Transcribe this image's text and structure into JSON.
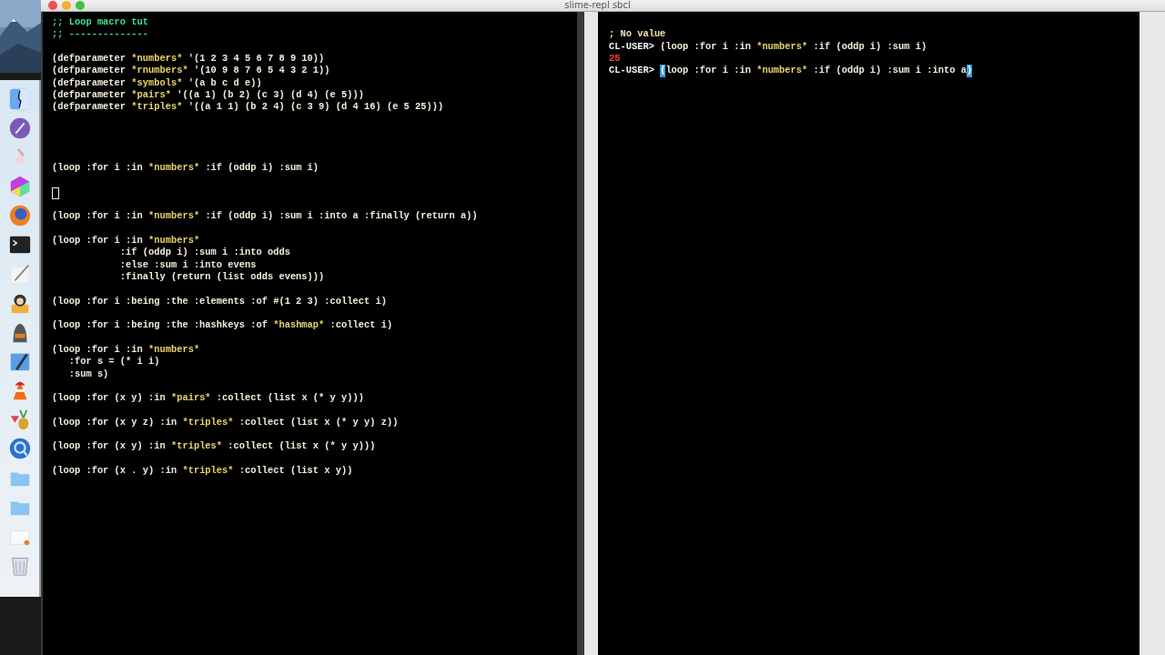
{
  "window": {
    "title": "slime-repl sbcl"
  },
  "editor": {
    "lines": [
      {
        "kind": "code",
        "segments": [
          {
            "kind": "comment",
            "text": ";; Loop macro tut"
          }
        ]
      },
      {
        "kind": "code",
        "segments": [
          {
            "kind": "comment",
            "text": ";; --------------"
          }
        ]
      },
      {
        "kind": "blank"
      },
      {
        "kind": "code",
        "segments": [
          {
            "kind": "plain",
            "text": "(defparameter "
          },
          {
            "kind": "special",
            "text": "*numbers*"
          },
          {
            "kind": "plain",
            "text": " '(1 2 3 4 5 6 7 8 9 10))"
          }
        ]
      },
      {
        "kind": "code",
        "segments": [
          {
            "kind": "plain",
            "text": "(defparameter "
          },
          {
            "kind": "special",
            "text": "*rnumbers*"
          },
          {
            "kind": "plain",
            "text": " '(10 9 8 7 6 5 4 3 2 1))"
          }
        ]
      },
      {
        "kind": "code",
        "segments": [
          {
            "kind": "plain",
            "text": "(defparameter "
          },
          {
            "kind": "special",
            "text": "*symbols*"
          },
          {
            "kind": "plain",
            "text": " '(a b c d e))"
          }
        ]
      },
      {
        "kind": "code",
        "segments": [
          {
            "kind": "plain",
            "text": "(defparameter "
          },
          {
            "kind": "special",
            "text": "*pairs*"
          },
          {
            "kind": "plain",
            "text": " '((a 1) (b 2) (c 3) (d 4) (e 5)))"
          }
        ]
      },
      {
        "kind": "code",
        "segments": [
          {
            "kind": "plain",
            "text": "(defparameter "
          },
          {
            "kind": "special",
            "text": "*triples*"
          },
          {
            "kind": "plain",
            "text": " '((a 1 1) (b 2 4) (c 3 9) (d 4 16) (e 5 25)))"
          }
        ]
      },
      {
        "kind": "blank"
      },
      {
        "kind": "blank"
      },
      {
        "kind": "blank"
      },
      {
        "kind": "blank"
      },
      {
        "kind": "code",
        "segments": [
          {
            "kind": "plain",
            "text": "(loop :for i :in "
          },
          {
            "kind": "special",
            "text": "*numbers*"
          },
          {
            "kind": "plain",
            "text": " :if (oddp i) :sum i)"
          }
        ]
      },
      {
        "kind": "blank"
      },
      {
        "kind": "cursor"
      },
      {
        "kind": "blank"
      },
      {
        "kind": "code",
        "segments": [
          {
            "kind": "plain",
            "text": "(loop :for i :in "
          },
          {
            "kind": "special",
            "text": "*numbers*"
          },
          {
            "kind": "plain",
            "text": " :if (oddp i) :sum i :into a :finally (return a))"
          }
        ]
      },
      {
        "kind": "blank"
      },
      {
        "kind": "code",
        "segments": [
          {
            "kind": "plain",
            "text": "(loop :for i :in "
          },
          {
            "kind": "special",
            "text": "*numbers*"
          }
        ]
      },
      {
        "kind": "code",
        "segments": [
          {
            "kind": "plain",
            "text": "            :if (oddp i) :sum i :into odds"
          }
        ]
      },
      {
        "kind": "code",
        "segments": [
          {
            "kind": "plain",
            "text": "            :else :sum i :into evens"
          }
        ]
      },
      {
        "kind": "code",
        "segments": [
          {
            "kind": "plain",
            "text": "            :finally (return (list odds evens)))"
          }
        ]
      },
      {
        "kind": "blank"
      },
      {
        "kind": "code",
        "segments": [
          {
            "kind": "plain",
            "text": "(loop :for i :being :the :elements :of #(1 2 3) :collect i)"
          }
        ]
      },
      {
        "kind": "blank"
      },
      {
        "kind": "code",
        "segments": [
          {
            "kind": "plain",
            "text": "(loop :for i :being :the :hashkeys :of "
          },
          {
            "kind": "special",
            "text": "*hashmap*"
          },
          {
            "kind": "plain",
            "text": " :collect i)"
          }
        ]
      },
      {
        "kind": "blank"
      },
      {
        "kind": "code",
        "segments": [
          {
            "kind": "plain",
            "text": "(loop :for i :in "
          },
          {
            "kind": "special",
            "text": "*numbers*"
          }
        ]
      },
      {
        "kind": "code",
        "segments": [
          {
            "kind": "plain",
            "text": "   :for s = (* i i)"
          }
        ]
      },
      {
        "kind": "code",
        "segments": [
          {
            "kind": "plain",
            "text": "   :sum s)"
          }
        ]
      },
      {
        "kind": "blank"
      },
      {
        "kind": "code",
        "segments": [
          {
            "kind": "plain",
            "text": "(loop :for (x y) :in "
          },
          {
            "kind": "special",
            "text": "*pairs*"
          },
          {
            "kind": "plain",
            "text": " :collect (list x (* y y)))"
          }
        ]
      },
      {
        "kind": "blank"
      },
      {
        "kind": "code",
        "segments": [
          {
            "kind": "plain",
            "text": "(loop :for (x y z) :in "
          },
          {
            "kind": "special",
            "text": "*triples*"
          },
          {
            "kind": "plain",
            "text": " :collect (list x (* y y) z))"
          }
        ]
      },
      {
        "kind": "blank"
      },
      {
        "kind": "code",
        "segments": [
          {
            "kind": "plain",
            "text": "(loop :for (x y) :in "
          },
          {
            "kind": "special",
            "text": "*triples*"
          },
          {
            "kind": "plain",
            "text": " :collect (list x (* y y)))"
          }
        ]
      },
      {
        "kind": "blank"
      },
      {
        "kind": "code",
        "segments": [
          {
            "kind": "plain",
            "text": "(loop :for (x . y) :in "
          },
          {
            "kind": "special",
            "text": "*triples*"
          },
          {
            "kind": "plain",
            "text": " :collect (list x y))"
          }
        ]
      }
    ]
  },
  "repl": {
    "lines": [
      {
        "kind": "blank"
      },
      {
        "kind": "code",
        "segments": [
          {
            "kind": "output",
            "text": "; No value"
          }
        ]
      },
      {
        "kind": "code",
        "segments": [
          {
            "kind": "prompt",
            "text": "CL-USER> "
          },
          {
            "kind": "plain",
            "text": "(loop :for i :in "
          },
          {
            "kind": "special",
            "text": "*numbers*"
          },
          {
            "kind": "plain",
            "text": " :if (oddp i) :sum i)"
          }
        ]
      },
      {
        "kind": "code",
        "segments": [
          {
            "kind": "result",
            "text": "25"
          }
        ]
      },
      {
        "kind": "code",
        "segments": [
          {
            "kind": "prompt",
            "text": "CL-USER> "
          },
          {
            "kind": "match",
            "text": "("
          },
          {
            "kind": "plain",
            "text": "loop :for i :in "
          },
          {
            "kind": "special",
            "text": "*numbers*"
          },
          {
            "kind": "plain",
            "text": " :if (oddp i) :sum i :into a"
          },
          {
            "kind": "match",
            "text": ")"
          }
        ]
      }
    ]
  }
}
